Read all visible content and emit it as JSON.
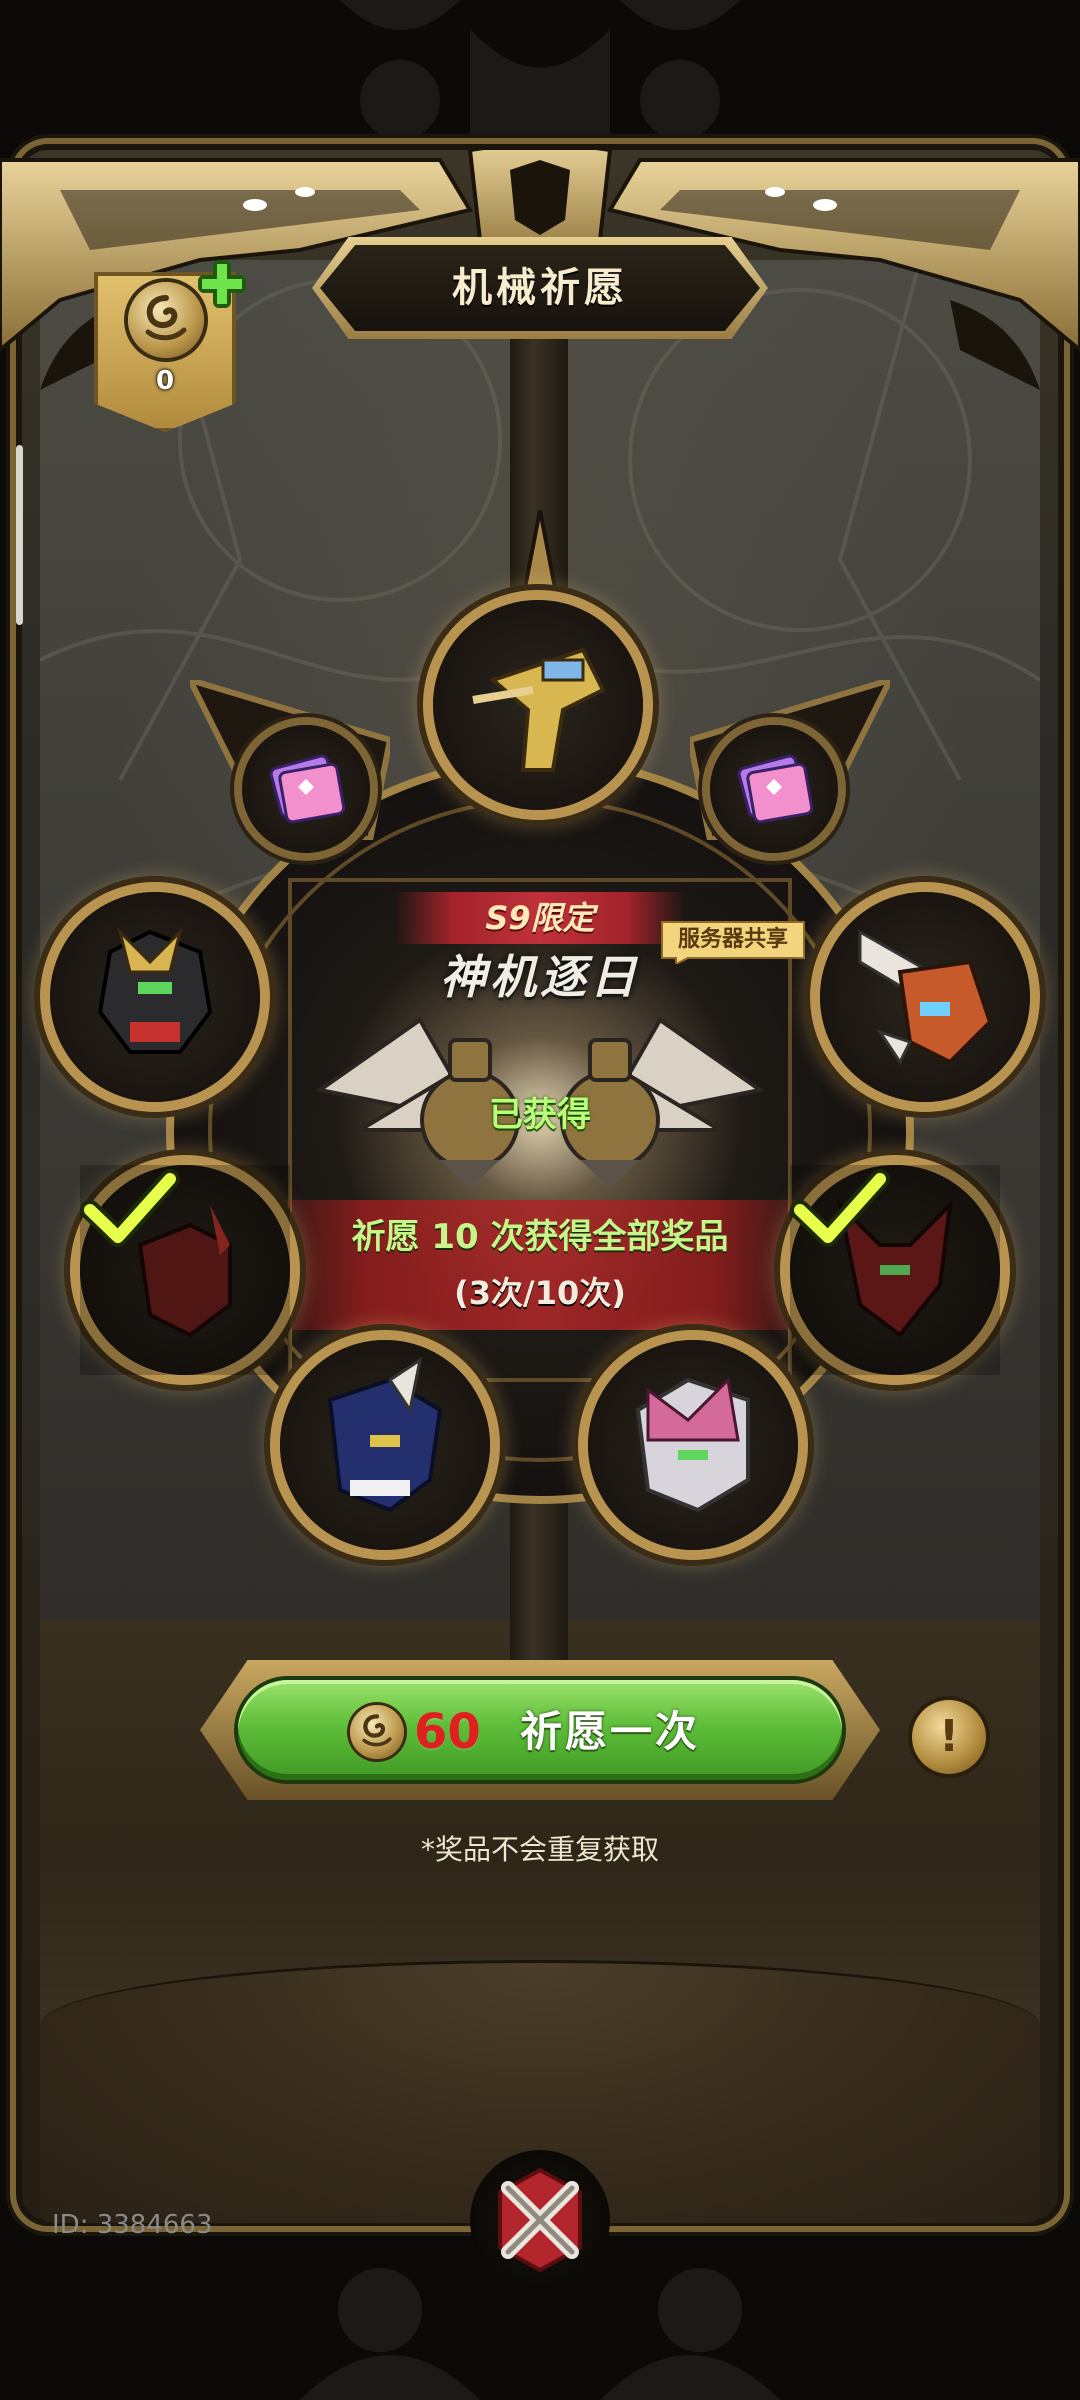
{
  "header": {
    "title": "机械祈愿",
    "currency_count": "0"
  },
  "center": {
    "limited_label": "S9限定",
    "set_name": "神机逐日",
    "server_shared": "服务器共享",
    "obtained": "已获得",
    "progress_text": "祈愿 10 次获得全部奖品",
    "progress_count": "(3次/10次)"
  },
  "prizes": [
    {
      "name": "gold-mech",
      "obtained": false
    },
    {
      "name": "ticket",
      "obtained": false
    },
    {
      "name": "ticket",
      "obtained": false
    },
    {
      "name": "black-gold-mech",
      "obtained": false
    },
    {
      "name": "orange-white-mech",
      "obtained": false
    },
    {
      "name": "red-mech",
      "obtained": true
    },
    {
      "name": "red-horned-mech",
      "obtained": true
    },
    {
      "name": "blue-mech",
      "obtained": false
    },
    {
      "name": "pink-mech",
      "obtained": false
    }
  ],
  "wish": {
    "cost": "60",
    "label": "祈愿一次",
    "info": "!"
  },
  "disclaimer": "*奖品不会重复获取",
  "user_id": "ID: 3384663",
  "colors": {
    "gold": "#c9a95a",
    "green_button": "#5fbe3a",
    "cost_red": "#e01f1f",
    "limited_red": "#b02a30"
  }
}
